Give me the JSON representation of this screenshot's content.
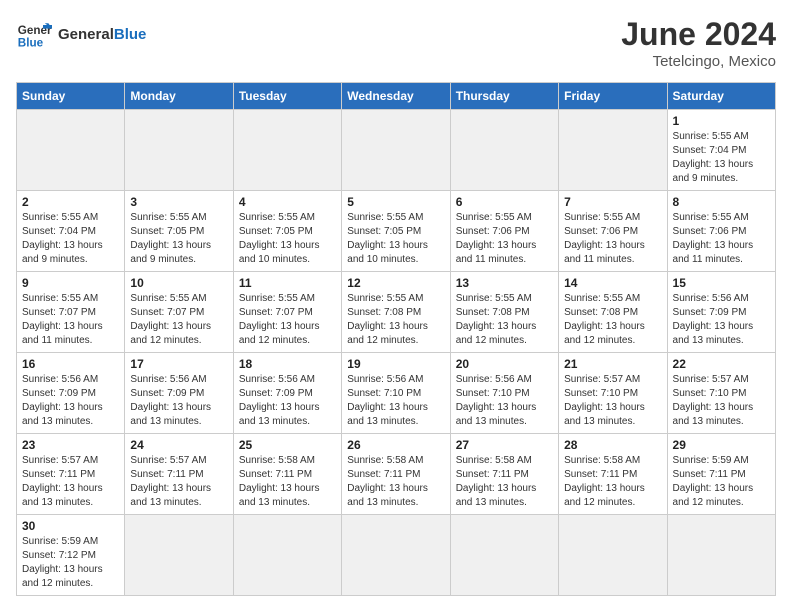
{
  "header": {
    "logo_text_general": "General",
    "logo_text_blue": "Blue",
    "month_year": "June 2024",
    "location": "Tetelcingo, Mexico"
  },
  "weekdays": [
    "Sunday",
    "Monday",
    "Tuesday",
    "Wednesday",
    "Thursday",
    "Friday",
    "Saturday"
  ],
  "weeks": [
    [
      {
        "day": null,
        "info": null
      },
      {
        "day": null,
        "info": null
      },
      {
        "day": null,
        "info": null
      },
      {
        "day": null,
        "info": null
      },
      {
        "day": null,
        "info": null
      },
      {
        "day": null,
        "info": null
      },
      {
        "day": "1",
        "info": "Sunrise: 5:55 AM\nSunset: 7:04 PM\nDaylight: 13 hours\nand 9 minutes."
      }
    ],
    [
      {
        "day": "2",
        "info": "Sunrise: 5:55 AM\nSunset: 7:04 PM\nDaylight: 13 hours\nand 9 minutes."
      },
      {
        "day": "3",
        "info": "Sunrise: 5:55 AM\nSunset: 7:05 PM\nDaylight: 13 hours\nand 9 minutes."
      },
      {
        "day": "4",
        "info": "Sunrise: 5:55 AM\nSunset: 7:05 PM\nDaylight: 13 hours\nand 10 minutes."
      },
      {
        "day": "5",
        "info": "Sunrise: 5:55 AM\nSunset: 7:05 PM\nDaylight: 13 hours\nand 10 minutes."
      },
      {
        "day": "6",
        "info": "Sunrise: 5:55 AM\nSunset: 7:06 PM\nDaylight: 13 hours\nand 11 minutes."
      },
      {
        "day": "7",
        "info": "Sunrise: 5:55 AM\nSunset: 7:06 PM\nDaylight: 13 hours\nand 11 minutes."
      },
      {
        "day": "8",
        "info": "Sunrise: 5:55 AM\nSunset: 7:06 PM\nDaylight: 13 hours\nand 11 minutes."
      }
    ],
    [
      {
        "day": "9",
        "info": "Sunrise: 5:55 AM\nSunset: 7:07 PM\nDaylight: 13 hours\nand 11 minutes."
      },
      {
        "day": "10",
        "info": "Sunrise: 5:55 AM\nSunset: 7:07 PM\nDaylight: 13 hours\nand 12 minutes."
      },
      {
        "day": "11",
        "info": "Sunrise: 5:55 AM\nSunset: 7:07 PM\nDaylight: 13 hours\nand 12 minutes."
      },
      {
        "day": "12",
        "info": "Sunrise: 5:55 AM\nSunset: 7:08 PM\nDaylight: 13 hours\nand 12 minutes."
      },
      {
        "day": "13",
        "info": "Sunrise: 5:55 AM\nSunset: 7:08 PM\nDaylight: 13 hours\nand 12 minutes."
      },
      {
        "day": "14",
        "info": "Sunrise: 5:55 AM\nSunset: 7:08 PM\nDaylight: 13 hours\nand 12 minutes."
      },
      {
        "day": "15",
        "info": "Sunrise: 5:56 AM\nSunset: 7:09 PM\nDaylight: 13 hours\nand 13 minutes."
      }
    ],
    [
      {
        "day": "16",
        "info": "Sunrise: 5:56 AM\nSunset: 7:09 PM\nDaylight: 13 hours\nand 13 minutes."
      },
      {
        "day": "17",
        "info": "Sunrise: 5:56 AM\nSunset: 7:09 PM\nDaylight: 13 hours\nand 13 minutes."
      },
      {
        "day": "18",
        "info": "Sunrise: 5:56 AM\nSunset: 7:09 PM\nDaylight: 13 hours\nand 13 minutes."
      },
      {
        "day": "19",
        "info": "Sunrise: 5:56 AM\nSunset: 7:10 PM\nDaylight: 13 hours\nand 13 minutes."
      },
      {
        "day": "20",
        "info": "Sunrise: 5:56 AM\nSunset: 7:10 PM\nDaylight: 13 hours\nand 13 minutes."
      },
      {
        "day": "21",
        "info": "Sunrise: 5:57 AM\nSunset: 7:10 PM\nDaylight: 13 hours\nand 13 minutes."
      },
      {
        "day": "22",
        "info": "Sunrise: 5:57 AM\nSunset: 7:10 PM\nDaylight: 13 hours\nand 13 minutes."
      }
    ],
    [
      {
        "day": "23",
        "info": "Sunrise: 5:57 AM\nSunset: 7:11 PM\nDaylight: 13 hours\nand 13 minutes."
      },
      {
        "day": "24",
        "info": "Sunrise: 5:57 AM\nSunset: 7:11 PM\nDaylight: 13 hours\nand 13 minutes."
      },
      {
        "day": "25",
        "info": "Sunrise: 5:58 AM\nSunset: 7:11 PM\nDaylight: 13 hours\nand 13 minutes."
      },
      {
        "day": "26",
        "info": "Sunrise: 5:58 AM\nSunset: 7:11 PM\nDaylight: 13 hours\nand 13 minutes."
      },
      {
        "day": "27",
        "info": "Sunrise: 5:58 AM\nSunset: 7:11 PM\nDaylight: 13 hours\nand 13 minutes."
      },
      {
        "day": "28",
        "info": "Sunrise: 5:58 AM\nSunset: 7:11 PM\nDaylight: 13 hours\nand 12 minutes."
      },
      {
        "day": "29",
        "info": "Sunrise: 5:59 AM\nSunset: 7:11 PM\nDaylight: 13 hours\nand 12 minutes."
      }
    ],
    [
      {
        "day": "30",
        "info": "Sunrise: 5:59 AM\nSunset: 7:12 PM\nDaylight: 13 hours\nand 12 minutes."
      },
      {
        "day": null,
        "info": null
      },
      {
        "day": null,
        "info": null
      },
      {
        "day": null,
        "info": null
      },
      {
        "day": null,
        "info": null
      },
      {
        "day": null,
        "info": null
      },
      {
        "day": null,
        "info": null
      }
    ]
  ]
}
